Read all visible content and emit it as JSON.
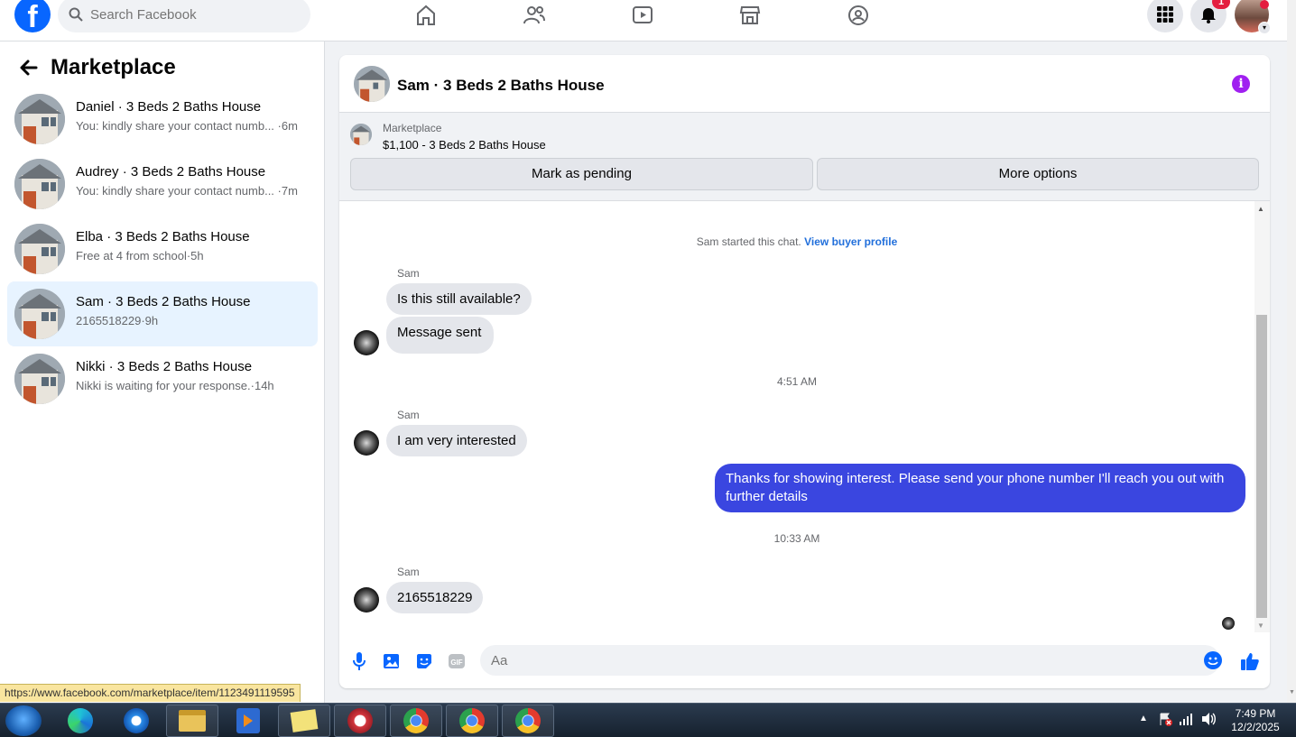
{
  "topbar": {
    "search_placeholder": "Search Facebook",
    "notification_count": "1",
    "brand_color": "#0866ff"
  },
  "sidebar": {
    "title": "Marketplace",
    "conversations": [
      {
        "title": "Daniel · 3 Beds 2 Baths House",
        "preview": "You: kindly share your contact numb...",
        "time": "·6m"
      },
      {
        "title": "Audrey · 3 Beds 2 Baths House",
        "preview": "You: kindly share your contact numb...",
        "time": "·7m"
      },
      {
        "title": "Elba · 3 Beds 2 Baths House",
        "preview": "Free at 4 from school",
        "time": "·5h"
      },
      {
        "title": "Sam · 3 Beds 2 Baths House",
        "preview": "2165518229",
        "time": "·9h"
      },
      {
        "title": "Nikki · 3 Beds 2 Baths House",
        "preview": "Nikki is waiting for your response.",
        "time": "·14h"
      }
    ]
  },
  "status_url": "https://www.facebook.com/marketplace/item/1123491119595",
  "chat": {
    "title": "Sam · 3 Beds 2 Baths House",
    "listing": {
      "category": "Marketplace",
      "name": "$1,100 - 3 Beds 2 Baths House",
      "mark_pending_label": "Mark as pending",
      "more_options_label": "More options"
    },
    "system_note": "Sam started this chat.",
    "system_link": "View buyer profile",
    "messages": [
      {
        "sender": "Sam",
        "text": "Is this still available?"
      },
      {
        "text": "Message sent"
      },
      {
        "time": "4:51 AM"
      },
      {
        "sender": "Sam",
        "text": "I am very interested"
      },
      {
        "outgoing": true,
        "text": "Thanks for showing interest. Please send your phone number  I'll reach you out with further details"
      },
      {
        "time": "10:33 AM"
      },
      {
        "sender": "Sam",
        "text": "2165518229"
      }
    ],
    "composer_placeholder": "Aa",
    "outgoing_color": "#3a46e0"
  },
  "taskbar": {
    "clock_time": "7:49 PM",
    "clock_date": "12/2/2025"
  }
}
